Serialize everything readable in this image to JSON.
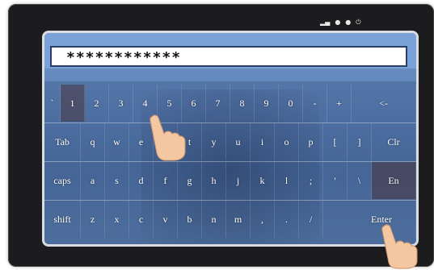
{
  "password": {
    "value": "************"
  },
  "keyboard": {
    "row1": [
      "`",
      "1",
      "2",
      "3",
      "4",
      "5",
      "6",
      "7",
      "8",
      "9",
      "0",
      "-",
      "+",
      "<-"
    ],
    "row2": [
      "Tab",
      "q",
      "w",
      "e",
      "r",
      "t",
      "y",
      "u",
      "i",
      "o",
      "p",
      "[",
      "]",
      "Clr"
    ],
    "row3": [
      "caps",
      "a",
      "s",
      "d",
      "f",
      "g",
      "h",
      "j",
      "k",
      "l",
      ";",
      "'",
      "\\",
      "En"
    ],
    "row4": [
      "shift",
      "z",
      "x",
      "c",
      "v",
      "b",
      "n",
      "m",
      ",",
      ".",
      "/",
      "Enter"
    ]
  },
  "icons": {
    "status": [
      "signal-icon",
      "dot-icon",
      "dot-icon",
      "power-icon"
    ],
    "hands": [
      "pointing-hand-icon",
      "pointing-hand-icon"
    ]
  }
}
